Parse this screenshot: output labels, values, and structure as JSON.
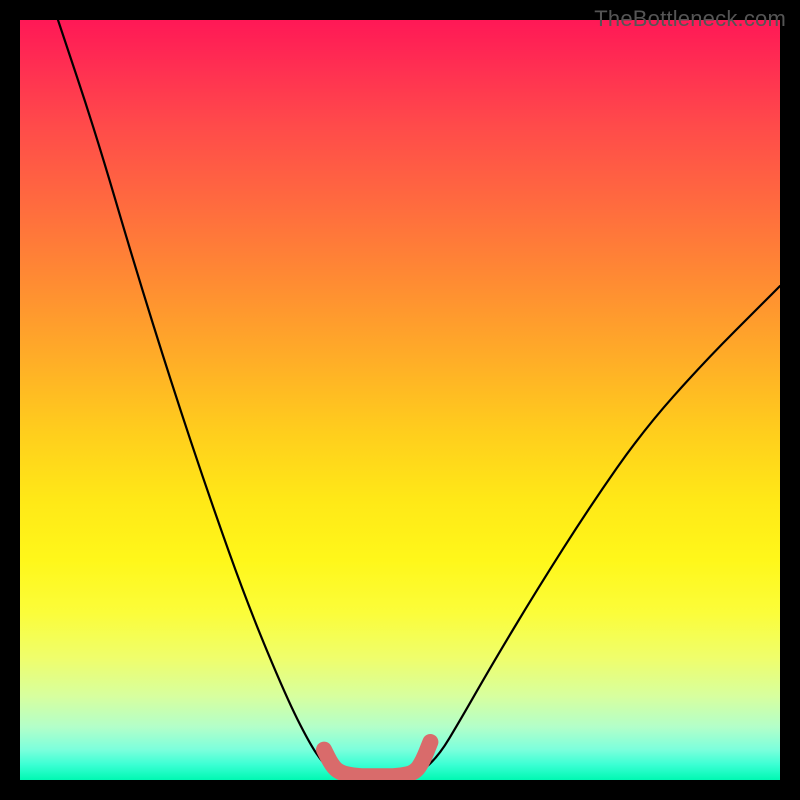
{
  "watermark": "TheBottleneck.com",
  "chart_data": {
    "type": "line",
    "title": "",
    "xlabel": "",
    "ylabel": "",
    "xlim": [
      0,
      100
    ],
    "ylim": [
      0,
      100
    ],
    "series": [
      {
        "name": "bottleneck-curve-left",
        "x": [
          5,
          10,
          15,
          20,
          25,
          30,
          35,
          38,
          40,
          42
        ],
        "y": [
          100,
          85,
          68,
          52,
          37,
          23,
          11,
          5,
          2,
          0.5
        ],
        "color": "#000000"
      },
      {
        "name": "bottleneck-curve-right",
        "x": [
          52,
          55,
          58,
          62,
          68,
          75,
          82,
          90,
          98,
          100
        ],
        "y": [
          0.5,
          3,
          8,
          15,
          25,
          36,
          46,
          55,
          63,
          65
        ],
        "color": "#000000"
      },
      {
        "name": "optimal-zone",
        "x": [
          40,
          41,
          42,
          44,
          46,
          48,
          50,
          52,
          53,
          54
        ],
        "y": [
          4,
          2,
          1,
          0.5,
          0.5,
          0.5,
          0.5,
          1,
          2.5,
          5
        ],
        "color": "#d96b6b"
      }
    ],
    "annotations": []
  },
  "colors": {
    "curve": "#000000",
    "highlight": "#d96b6b"
  }
}
